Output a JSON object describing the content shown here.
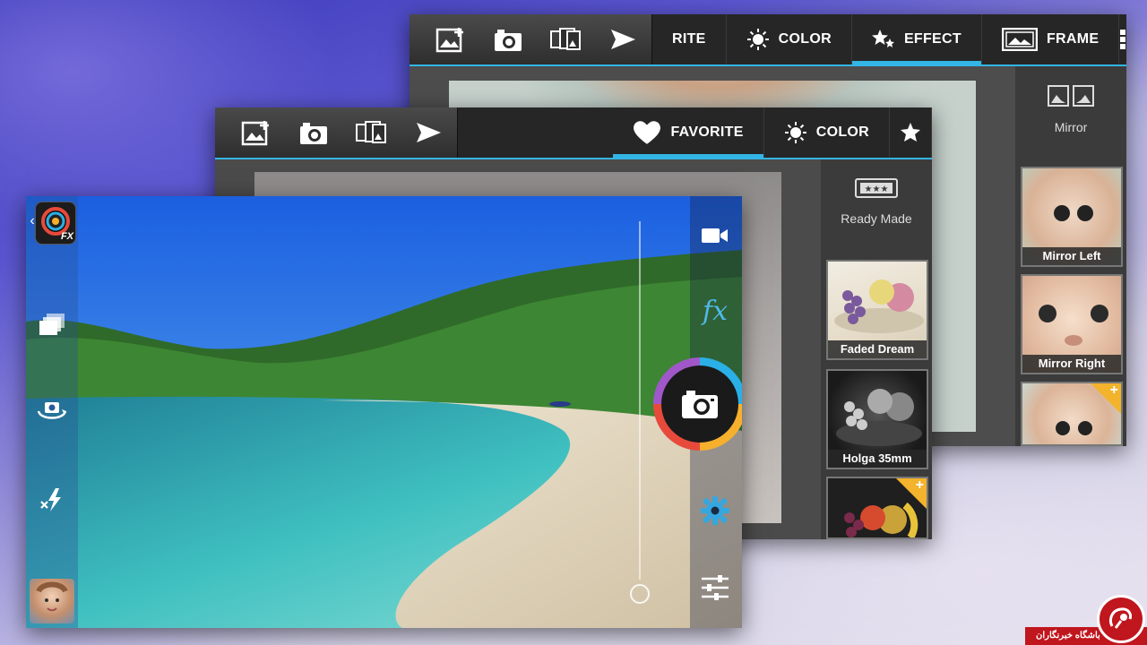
{
  "back_window": {
    "tabs": [
      {
        "label": "RITE",
        "icon": "favorite-icon"
      },
      {
        "label": "COLOR",
        "icon": "sun-icon"
      },
      {
        "label": "EFFECT",
        "icon": "stars-icon",
        "active": true
      },
      {
        "label": "FRAME",
        "icon": "frame-icon"
      }
    ],
    "panel_title": "Mirror",
    "thumbs": [
      "Mirror Left",
      "Mirror Right"
    ]
  },
  "middle_window": {
    "tabs": [
      {
        "label": "FAVORITE",
        "icon": "heart-icon",
        "active": true
      },
      {
        "label": "COLOR",
        "icon": "sun-icon"
      }
    ],
    "panel_title": "Ready Made",
    "thumbs": [
      "Faded Dream",
      "Holga 35mm"
    ]
  },
  "camera": {
    "app_badge": "FX",
    "fx_label": "fx",
    "zoom_level": 0.0
  },
  "watermark": {
    "text": "باشگاه خبرنگاران"
  },
  "colors": {
    "accent": "#33b5e5",
    "topbar": "#262626",
    "panel": "#3b3b3b"
  }
}
